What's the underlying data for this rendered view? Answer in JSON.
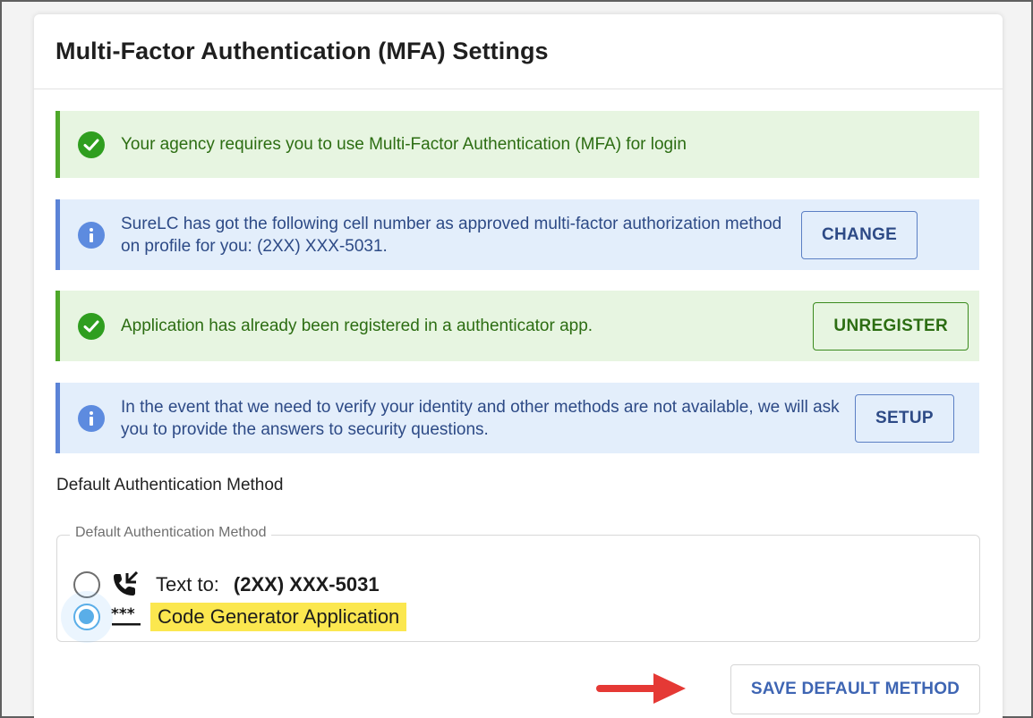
{
  "page": {
    "title": "Multi-Factor Authentication (MFA) Settings"
  },
  "alerts": [
    {
      "type": "success",
      "icon": "check-circle-icon",
      "text": "Your agency requires you to use Multi-Factor Authentication (MFA) for login"
    },
    {
      "type": "info",
      "icon": "info-circle-icon",
      "text": "SureLC has got the following cell number as approved multi-factor authorization method on profile for you: (2XX) XXX-5031.",
      "button": "CHANGE"
    },
    {
      "type": "success",
      "icon": "check-circle-icon",
      "text": "Application has already been registered in a authenticator app.",
      "button": "UNREGISTER"
    },
    {
      "type": "info",
      "icon": "info-circle-icon",
      "text": "In the event that we need to verify your identity and other methods are not available, we will ask you to provide the answers to security questions.",
      "button": "SETUP"
    }
  ],
  "default_method": {
    "section_label": "Default Authentication Method",
    "legend": "Default Authentication Method",
    "options": [
      {
        "icon": "phone-forward-icon",
        "label": "Text to:",
        "value": "(2XX) XXX-5031",
        "selected": false
      },
      {
        "icon": "password-asterisk-icon",
        "label": "Code Generator Application",
        "selected": true
      }
    ]
  },
  "actions": {
    "save_label": "SAVE DEFAULT METHOD"
  },
  "colors": {
    "success_bg": "#e7f5e1",
    "success_border": "#4ea72a",
    "info_bg": "#e3eefb",
    "info_border": "#5b83d6",
    "accent": "#3e65b3",
    "highlight": "#fbe74f",
    "annotation_arrow": "#e53935"
  }
}
